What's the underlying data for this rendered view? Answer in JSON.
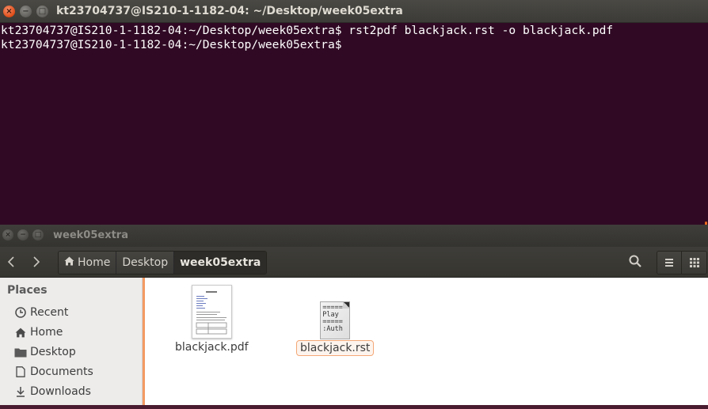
{
  "terminal": {
    "title": "kt23704737@IS210-1-1182-04: ~/Desktop/week05extra",
    "lines": [
      "kt23704737@IS210-1-1182-04:~/Desktop/week05extra$ rst2pdf blackjack.rst -o blackjack.pdf",
      "kt23704737@IS210-1-1182-04:~/Desktop/week05extra$"
    ],
    "colors": {
      "background": "#300a24",
      "text": "#ffffff",
      "accent": "#e96a1d"
    }
  },
  "file_manager": {
    "title": "week05extra",
    "toolbar": {
      "back_icon": "chevron-left-icon",
      "forward_icon": "chevron-right-icon",
      "breadcrumbs": [
        {
          "label": "Home",
          "icon": "home-icon"
        },
        {
          "label": "Desktop"
        },
        {
          "label": "week05extra",
          "active": true
        }
      ],
      "search_icon": "search-icon",
      "menu_icon": "list-icon",
      "view_icon": "grid-icon"
    },
    "sidebar": {
      "title": "Places",
      "items": [
        {
          "label": "Recent",
          "icon": "clock-icon"
        },
        {
          "label": "Home",
          "icon": "home-icon"
        },
        {
          "label": "Desktop",
          "icon": "folder-icon"
        },
        {
          "label": "Documents",
          "icon": "document-icon"
        },
        {
          "label": "Downloads",
          "icon": "download-icon"
        }
      ]
    },
    "files": [
      {
        "name": "blackjack.pdf",
        "type": "pdf",
        "selected": false
      },
      {
        "name": "blackjack.rst",
        "type": "rst",
        "selected": true,
        "preview": "=====\nPlay\n=====\n:Auth"
      }
    ]
  }
}
